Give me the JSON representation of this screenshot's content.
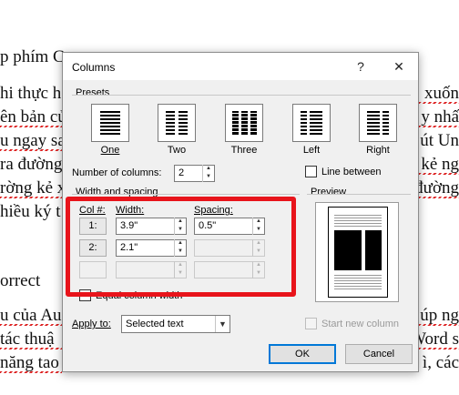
{
  "background_doc": {
    "lines_left": [
      "p phím C",
      "hi thực h",
      "ên bản củ",
      "u ngay sa",
      "ra đường",
      "rờng kẻ x",
      "hiều ký t",
      "",
      "orrect",
      "u của Au",
      " tác thuậ",
      "năng tao"
    ],
    "lines_right": [
      "xuốn",
      "y nhấ",
      "út Un",
      "kẻ ng",
      "đường",
      "",
      "",
      "",
      "",
      "úp ng",
      "Word s",
      "ì, các"
    ]
  },
  "dialog": {
    "title": "Columns",
    "help_label": "?",
    "close_label": "✕",
    "presets": {
      "label": "Presets",
      "items": [
        {
          "label": "One"
        },
        {
          "label": "Two"
        },
        {
          "label": "Three"
        },
        {
          "label": "Left"
        },
        {
          "label": "Right"
        }
      ]
    },
    "number_of_columns": {
      "label": "Number of columns:",
      "value": "2"
    },
    "line_between": {
      "label": "Line between",
      "checked": false
    },
    "width_spacing": {
      "label": "Width and spacing",
      "col_header": "Col #:",
      "width_header": "Width:",
      "spacing_header": "Spacing:",
      "rows": [
        {
          "col": "1:",
          "width": "3.9\"",
          "spacing": "0.5\""
        },
        {
          "col": "2:",
          "width": "2.1\"",
          "spacing": ""
        },
        {
          "col": "",
          "width": "",
          "spacing": ""
        }
      ]
    },
    "equal_column_width": {
      "label": "Equal column width",
      "checked": false
    },
    "preview_label": "Preview",
    "apply_to": {
      "label": "Apply to:",
      "value": "Selected text"
    },
    "start_new_column": {
      "label": "Start new column",
      "checked": false
    },
    "ok_label": "OK",
    "cancel_label": "Cancel"
  },
  "colors": {
    "highlight": "#e8141b",
    "focus": "#0078d7"
  }
}
